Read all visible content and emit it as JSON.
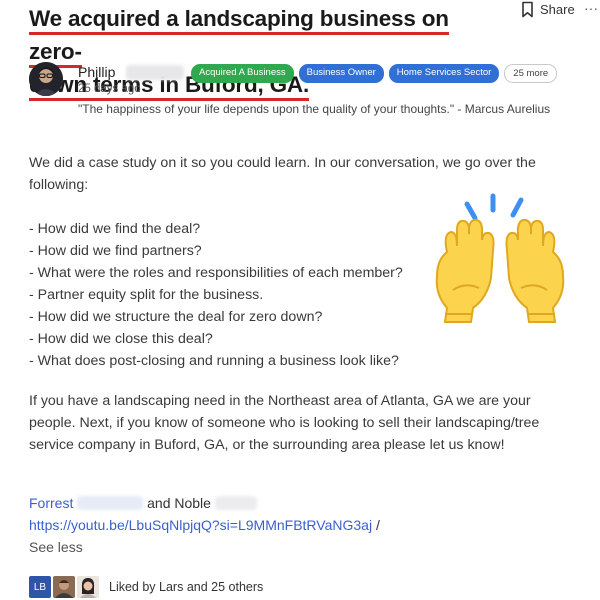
{
  "post": {
    "title_line1": "We acquired a landscaping business on zero-",
    "title_line2": "down terms in Buford, GA.",
    "share_label": "Share",
    "more_label": "···"
  },
  "author": {
    "name": "Phillip",
    "time": "25 days ago",
    "quote": "\"The happiness of your life depends upon the quality of your thoughts.\" - Marcus Aurelius"
  },
  "tags": [
    {
      "label": "Acquired A Business",
      "color": "#2fa84f"
    },
    {
      "label": "Business Owner",
      "color": "#2f6fd6"
    },
    {
      "label": "Home Services Sector",
      "color": "#2f6fd6"
    },
    {
      "label": "25 more"
    }
  ],
  "body": {
    "intro": "We did a case study on it so you could learn. In our conversation, we go over the following:",
    "list": [
      "- How did we find the deal?",
      "- How did we find partners?",
      "- What were the roles and responsibilities of each member?",
      "- Partner equity split for the business.",
      "- How did we structure the deal for zero down?",
      "- How did we close this deal?",
      "- What does post-closing and running a business look like?"
    ],
    "closing": "If you have a landscaping need in the Northeast area of Atlanta, GA we are your people. Next, if you know of someone who is looking to sell their landscaping/tree service company in Buford, GA, or the surrounding area please let us know!"
  },
  "mentions": {
    "first": "Forrest",
    "connector": "and Noble",
    "url": "https://youtu.be/LbuSqNlpjqQ?si=L9MMnFBtRVaNG3aj",
    "url_suffix": " /",
    "see_less": "See less"
  },
  "likes": {
    "initials": "LB",
    "text": "Liked by Lars and 25 others"
  },
  "icons": [
    "bookmark-icon",
    "raising-hands-emoji",
    "avatar"
  ],
  "colors": {
    "accent_red": "#d62828",
    "link_blue": "#3b5fce",
    "tag_green": "#2fa84f",
    "tag_blue": "#2f6fd6"
  }
}
